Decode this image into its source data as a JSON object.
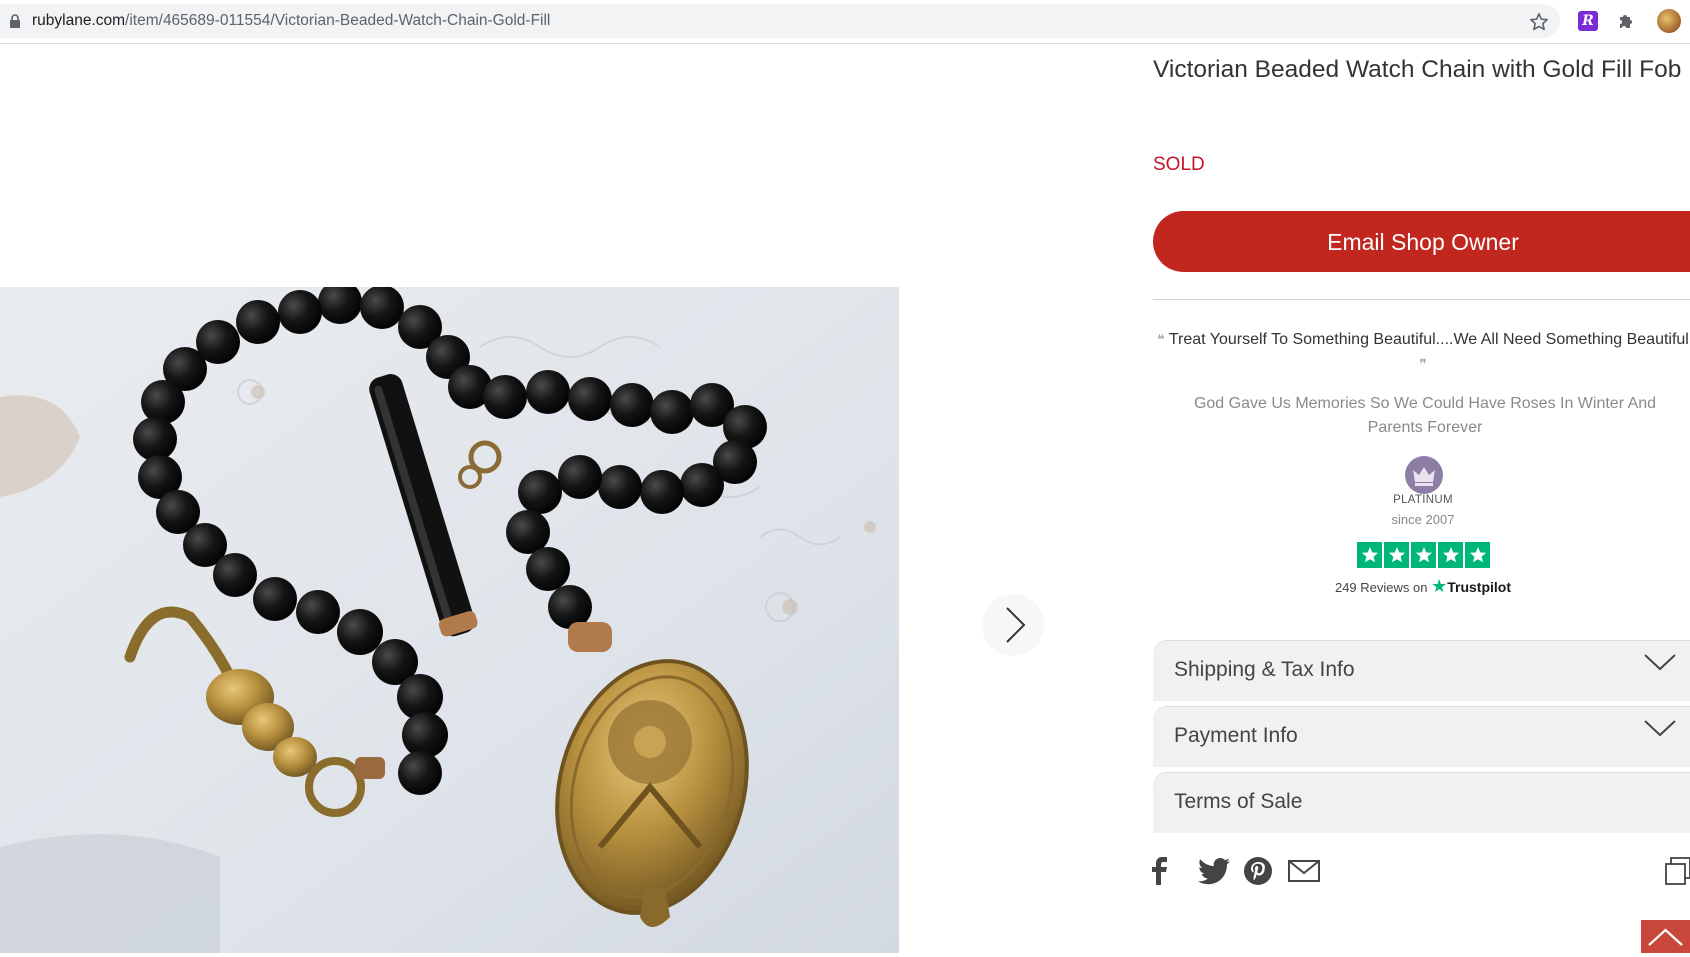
{
  "browser": {
    "url_domain": "rubylane.com",
    "url_path": "/item/465689-011554/Victorian-Beaded-Watch-Chain-Gold-Fill",
    "icons": [
      "lock-icon",
      "bookmark-star-icon",
      "extension-r-icon",
      "extensions-puzzle-icon",
      "profile-avatar"
    ]
  },
  "product": {
    "title": "Victorian Beaded Watch Chain with Gold Fill Fob",
    "status": "SOLD",
    "email_button": "Email Shop Owner"
  },
  "shop": {
    "tagline": "Treat Yourself To Something Beautiful....We All Need Something Beautiful",
    "motto": "God Gave Us Memories So We Could Have Roses In Winter And Parents Forever",
    "level": "PLATINUM",
    "since": "since 2007",
    "rating_stars": 5,
    "reviews_text": "249 Reviews on",
    "reviews_brand": "Trustpilot"
  },
  "accordions": [
    {
      "label": "Shipping & Tax Info"
    },
    {
      "label": "Payment Info"
    },
    {
      "label": "Terms of Sale"
    }
  ],
  "colors": {
    "accent_red": "#c1261f",
    "sold_red": "#c0152a",
    "trustpilot_green": "#00b67a"
  }
}
